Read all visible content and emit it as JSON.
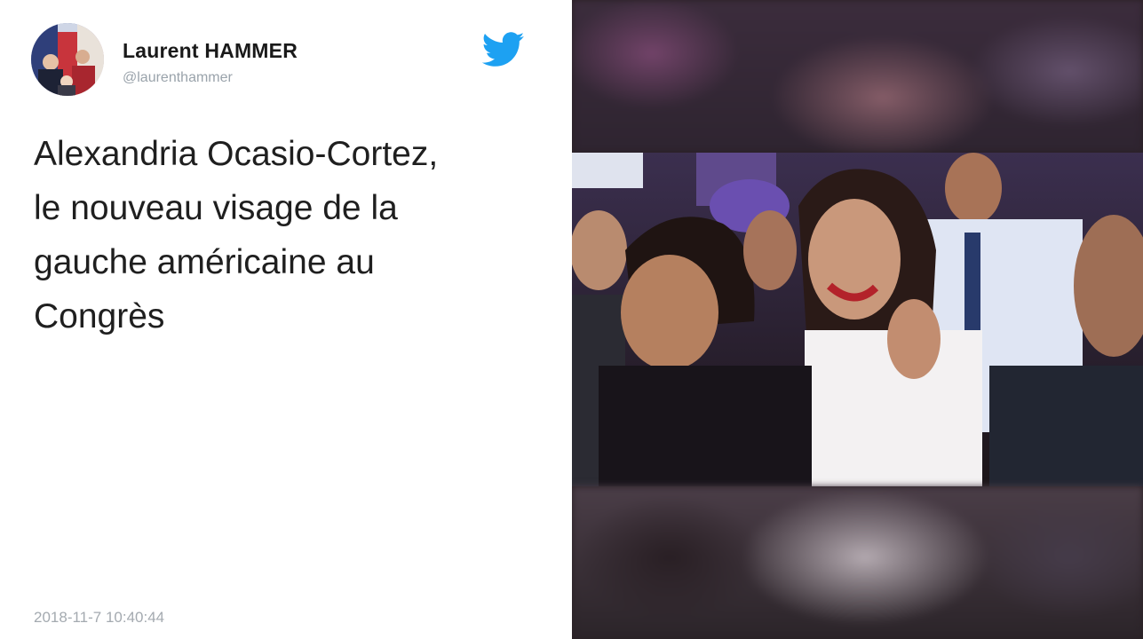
{
  "author": {
    "name": "Laurent HAMMER",
    "handle": "@laurenthammer"
  },
  "tweet": {
    "text": "Alexandria Ocasio-Cortez,\nle nouveau visage de la\ngauche américaine au\nCongrès",
    "timestamp": "2018-11-7 10:40:44"
  },
  "icons": {
    "brand": "twitter-bird-icon",
    "brand_color": "#1da1f2"
  },
  "media": {
    "alt": "photo"
  }
}
